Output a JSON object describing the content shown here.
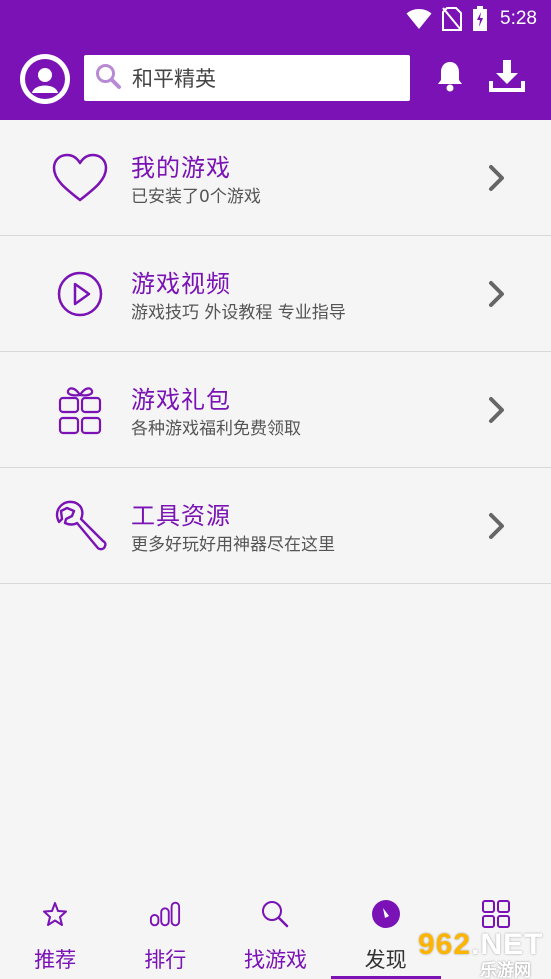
{
  "status_bar": {
    "time": "5:28",
    "icons": [
      "wifi-icon",
      "no-sim-icon",
      "battery-charging-icon"
    ]
  },
  "header": {
    "avatar_icon": "user-avatar-icon",
    "search": {
      "value": "和平精英",
      "icon": "search-icon"
    },
    "actions": [
      "bell-icon",
      "download-icon"
    ]
  },
  "menu": [
    {
      "title": "我的游戏",
      "subtitle": "已安装了0个游戏",
      "icon": "heart-icon"
    },
    {
      "title": "游戏视频",
      "subtitle": "游戏技巧 外设教程 专业指导",
      "icon": "play-circle-icon"
    },
    {
      "title": "游戏礼包",
      "subtitle": "各种游戏福利免费领取",
      "icon": "gift-icon"
    },
    {
      "title": "工具资源",
      "subtitle": "更多好玩好用神器尽在这里",
      "icon": "wrench-icon"
    }
  ],
  "bottom_nav": [
    {
      "label": "推荐",
      "icon": "star-icon",
      "active": false
    },
    {
      "label": "排行",
      "icon": "ranking-icon",
      "active": false
    },
    {
      "label": "找游戏",
      "icon": "search-icon",
      "active": false
    },
    {
      "label": "发现",
      "icon": "compass-icon",
      "active": true
    },
    {
      "label": "",
      "icon": "grid-icon",
      "active": false
    }
  ],
  "watermark": {
    "main_prefix": "962",
    "main_suffix": ".NET",
    "sub": "乐游网"
  },
  "colors": {
    "brand": "#7a12b6",
    "background": "#f5f5f5",
    "divider": "#d8d8d8",
    "subtext": "#555555",
    "chevron": "#666666"
  }
}
